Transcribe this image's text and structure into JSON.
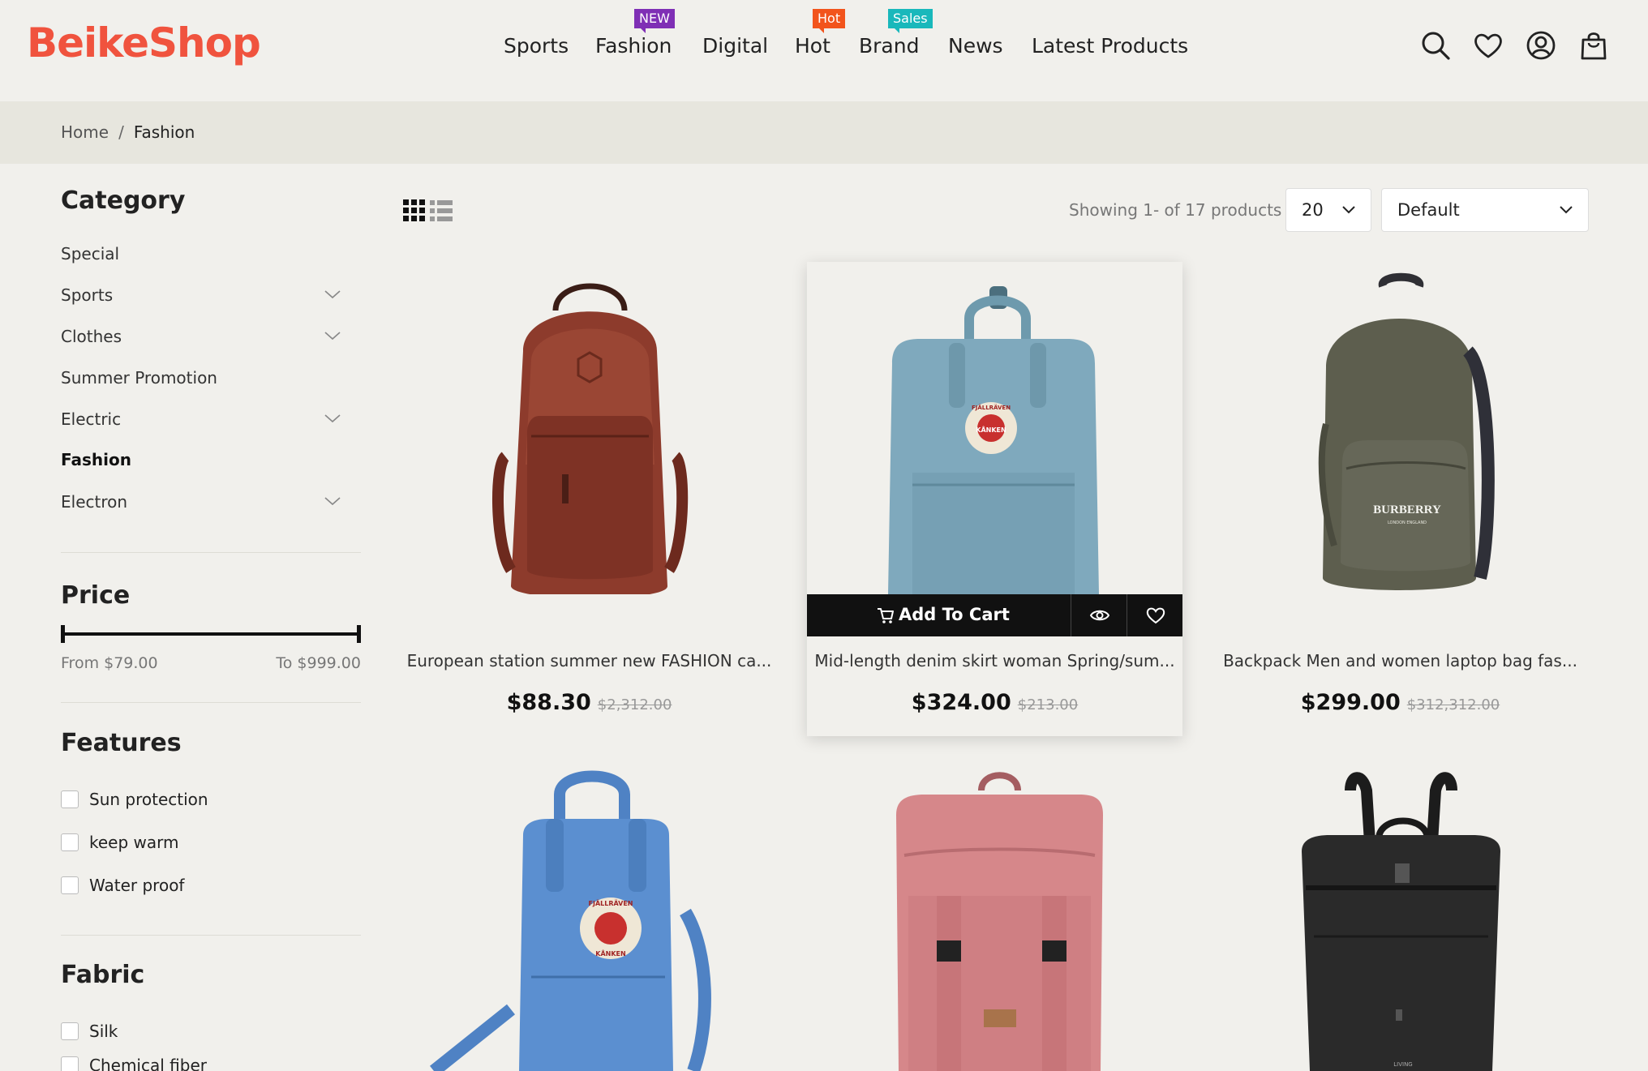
{
  "brand": {
    "logo": "BeikeShop",
    "accent": "#f0533e"
  },
  "nav": {
    "items": [
      {
        "label": "Sports"
      },
      {
        "label": "Fashion",
        "badge": "NEW",
        "badge_color": "#7f2fb5"
      },
      {
        "label": "Digital"
      },
      {
        "label": "Hot",
        "badge": "Hot",
        "badge_color": "#f2541c"
      },
      {
        "label": "Brand",
        "badge": "Sales",
        "badge_color": "#19b8bb"
      },
      {
        "label": "News"
      },
      {
        "label": "Latest Products"
      }
    ],
    "icons": [
      "search-icon",
      "heart-icon",
      "user-icon",
      "shopping-bag-icon"
    ]
  },
  "breadcrumb": {
    "home": "Home",
    "separator": "/",
    "current": "Fashion"
  },
  "sidebar": {
    "category_title": "Category",
    "categories": [
      {
        "label": "Special",
        "expandable": false
      },
      {
        "label": "Sports",
        "expandable": true
      },
      {
        "label": "Clothes",
        "expandable": true
      },
      {
        "label": "Summer Promotion",
        "expandable": false
      },
      {
        "label": "Electric",
        "expandable": true
      },
      {
        "label": "Fashion",
        "expandable": false,
        "active": true
      },
      {
        "label": "Electron",
        "expandable": true
      }
    ],
    "price_title": "Price",
    "price_from": "From $79.00",
    "price_to": "To $999.00",
    "features_title": "Features",
    "features": [
      "Sun protection",
      "keep warm",
      "Water proof"
    ],
    "fabric_title": "Fabric",
    "fabrics": [
      "Silk",
      "Chemical fiber"
    ]
  },
  "toolbar": {
    "showing": "Showing 1- of 17 products",
    "per_page": "20",
    "sort": "Default"
  },
  "products": [
    {
      "name": "European station summer new FASHION ca...",
      "price": "$88.30",
      "old_price": "$2,312.00",
      "color": "#8d3b2c"
    },
    {
      "name": "Mid-length denim skirt woman Spring/sum...",
      "price": "$324.00",
      "old_price": "$213.00",
      "color": "#7fa9bd",
      "hover": true
    },
    {
      "name": "Backpack Men and women laptop bag fas...",
      "price": "$299.00",
      "old_price": "$312,312.00",
      "color": "#5d5e4e"
    },
    {
      "name": "",
      "price": "",
      "old_price": "",
      "color": "#4f82c4"
    },
    {
      "name": "",
      "price": "",
      "old_price": "",
      "color": "#d6878a"
    },
    {
      "name": "",
      "price": "",
      "old_price": "",
      "color": "#2a2a2a"
    }
  ],
  "card_actions": {
    "add_to_cart": "Add To Cart"
  },
  "product_texts": {
    "burberry": "BURBERRY",
    "burberry_sub": "LONDON ENGLAND",
    "fjallraven": "FJÄLLRÄVEN",
    "kanken": "KÅNKEN",
    "living": "LIVING"
  }
}
